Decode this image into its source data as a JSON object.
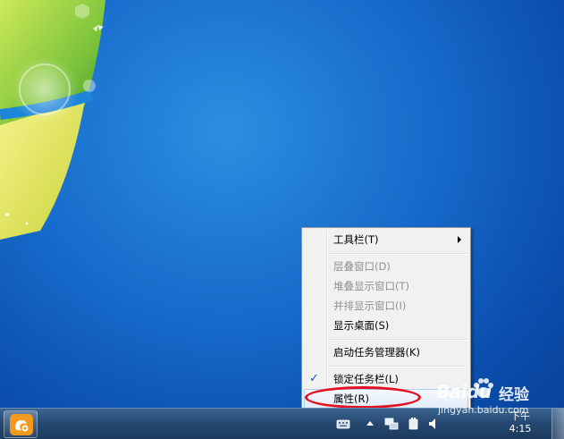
{
  "context_menu": {
    "items": [
      {
        "label": "工具栏(T)",
        "disabled": false,
        "submenu": true
      },
      {
        "label": "层叠窗口(D)",
        "disabled": true
      },
      {
        "label": "堆叠显示窗口(T)",
        "disabled": true
      },
      {
        "label": "并排显示窗口(I)",
        "disabled": true
      },
      {
        "label": "显示桌面(S)",
        "disabled": false
      },
      {
        "label": "启动任务管理器(K)",
        "disabled": false
      },
      {
        "label": "锁定任务栏(L)",
        "disabled": false,
        "checked": true
      },
      {
        "label": "属性(R)",
        "disabled": false,
        "highlighted": true
      }
    ]
  },
  "taskbar": {
    "pinned_app_icon": "uc-browser-icon",
    "tray_icons": [
      "keyboard-icon",
      "show-hidden-icons-arrow",
      "network-icon",
      "power-icon",
      "volume-icon"
    ],
    "clock_time": "下午 4:15"
  },
  "watermark": {
    "logo_text": "Bai",
    "logo_suffix": "du",
    "title": "经验",
    "url": "jingyan.baidu.com"
  },
  "colors": {
    "desktop": "#1669c9",
    "menu_background": "#f1f1f1",
    "highlight_ring": "#e4101f",
    "taskbar": "#25476f"
  }
}
